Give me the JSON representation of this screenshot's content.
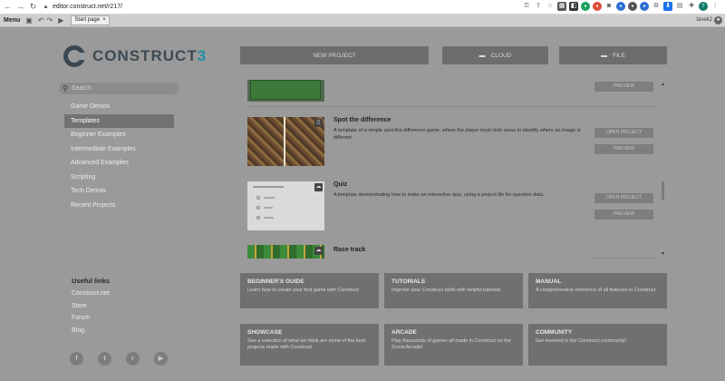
{
  "browser": {
    "url": "editor.construct.net/r217/"
  },
  "toolbar": {
    "menu_label": "Menu",
    "tab_label": "Start page",
    "tab_close": "×",
    "user_name": "tavek2"
  },
  "logo": {
    "text_main": "CONSTRUCT",
    "text_accent": "3"
  },
  "search": {
    "placeholder": "Search"
  },
  "sidebar": {
    "items": [
      {
        "label": "Game Demos"
      },
      {
        "label": "Templates"
      },
      {
        "label": "Beginner Examples"
      },
      {
        "label": "Intermediate Examples"
      },
      {
        "label": "Advanced Examples"
      },
      {
        "label": "Scripting"
      },
      {
        "label": "Tech Demos"
      },
      {
        "label": "Recent Projects"
      }
    ],
    "active_index": 1
  },
  "useful_links": {
    "heading": "Useful links",
    "items": [
      {
        "label": "Construct.net"
      },
      {
        "label": "Store"
      },
      {
        "label": "Forum"
      },
      {
        "label": "Blog"
      }
    ]
  },
  "social": {
    "facebook": "f",
    "twitter": "t",
    "reddit": "r",
    "youtube": "▶"
  },
  "top_buttons": {
    "new_project": "NEW PROJECT",
    "cloud": "CLOUD",
    "file": "FILE"
  },
  "templates": {
    "items": [
      {
        "title": "",
        "description": "",
        "preview_label": "PREVIEW"
      },
      {
        "title": "Spot the difference",
        "description": "A template of a simple spot-the-difference game, where the player must click areas to identify where an image is different.",
        "open_label": "OPEN PROJECT",
        "preview_label": "PREVIEW"
      },
      {
        "title": "Quiz",
        "description": "A template demonstrating how to make an interactive quiz, using a project file for question data.",
        "open_label": "OPEN PROJECT",
        "preview_label": "PREVIEW"
      },
      {
        "title": "Race track",
        "description": ""
      }
    ]
  },
  "cards": [
    {
      "title": "BEGINNER'S GUIDE",
      "desc": "Learn how to create your first game with Construct"
    },
    {
      "title": "TUTORIALS",
      "desc": "Improve your Construct skills with helpful tutorials"
    },
    {
      "title": "MANUAL",
      "desc": "A comprehensive reference of all features in Construct"
    },
    {
      "title": "SHOWCASE",
      "desc": "See a selection of what we think are some of the best projects made with Construct."
    },
    {
      "title": "ARCADE",
      "desc": "Play thousands of games all made in Construct on the Scirra Arcade!"
    },
    {
      "title": "COMMUNITY",
      "desc": "Get involved in the Construct community!"
    }
  ]
}
